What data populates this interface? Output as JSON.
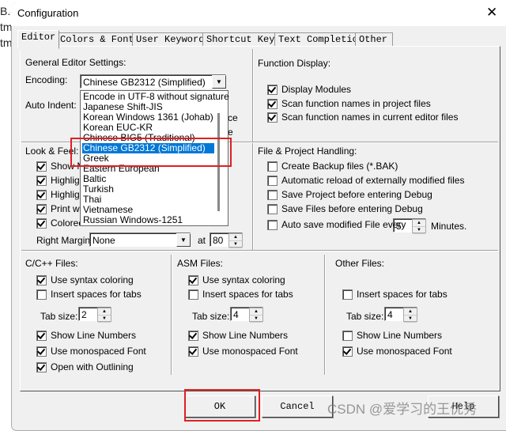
{
  "background": {
    "fragments": [
      "B.c",
      "tm",
      "tm"
    ]
  },
  "dialog": {
    "title": "Configuration",
    "close_icon": "close-icon"
  },
  "tabs": [
    {
      "label": "Editor",
      "active": true
    },
    {
      "label": "Colors & Fonts"
    },
    {
      "label": "User Keywords"
    },
    {
      "label": "Shortcut Keys"
    },
    {
      "label": "Text Completion"
    },
    {
      "label": "Other"
    }
  ],
  "general": {
    "heading": "General Editor Settings:",
    "encoding_label": "Encoding:",
    "encoding_value": "Chinese GB2312 (Simplified)",
    "auto_indent_label": "Auto Indent:",
    "hidden_fragments": [
      "ce",
      "e"
    ],
    "encoding_options": [
      "Encode in UTF-8 without signature",
      "Japanese Shift-JIS",
      "Korean Windows 1361 (Johab)",
      "Korean EUC-KR",
      "Chinese BIG5 (Traditional)",
      "Chinese GB2312 (Simplified)",
      "Greek",
      "Eastern European",
      "Baltic",
      "Turkish",
      "Thai",
      "Vietnamese",
      "Russian Windows-1251"
    ],
    "selected_index": 5
  },
  "function_display": {
    "heading": "Function Display:",
    "items": [
      {
        "label": "Display Modules",
        "checked": true
      },
      {
        "label": "Scan function names in project files",
        "checked": true
      },
      {
        "label": "Scan function names in current editor files",
        "checked": true
      }
    ]
  },
  "look_feel": {
    "heading": "Look & Feel:",
    "items": [
      {
        "label": "Show M",
        "checked": true
      },
      {
        "label": "Highligh",
        "checked": true
      },
      {
        "label": "Highligh",
        "checked": true
      },
      {
        "label": "Print wit",
        "checked": true
      },
      {
        "label": "Colored",
        "checked": true
      }
    ],
    "right_margin_label": "Right Margin:",
    "right_margin_value": "None",
    "at_label": "at",
    "at_value": "80"
  },
  "file_project": {
    "heading": "File & Project Handling:",
    "items": [
      {
        "label": "Create Backup files (*.BAK)",
        "checked": false
      },
      {
        "label": "Automatic reload of externally modified files",
        "checked": false
      },
      {
        "label": "Save Project before entering Debug",
        "checked": false
      },
      {
        "label": "Save Files before entering Debug",
        "checked": false
      },
      {
        "label": "Auto save modified File every",
        "checked": false
      }
    ],
    "autosave_value": "5",
    "minutes_label": "Minutes."
  },
  "cpp": {
    "heading": "C/C++ Files:",
    "syntax": {
      "label": "Use syntax coloring",
      "checked": true
    },
    "spaces": {
      "label": "Insert spaces for tabs",
      "checked": false
    },
    "tab_label": "Tab size:",
    "tab_value": "2",
    "lines": {
      "label": "Show Line Numbers",
      "checked": true
    },
    "mono": {
      "label": "Use monospaced Font",
      "checked": true
    },
    "outline": {
      "label": "Open with Outlining",
      "checked": true
    }
  },
  "asm": {
    "heading": "ASM Files:",
    "syntax": {
      "label": "Use syntax coloring",
      "checked": true
    },
    "spaces": {
      "label": "Insert spaces for tabs",
      "checked": false
    },
    "tab_label": "Tab size:",
    "tab_value": "4",
    "lines": {
      "label": "Show Line Numbers",
      "checked": true
    },
    "mono": {
      "label": "Use monospaced Font",
      "checked": true
    }
  },
  "other": {
    "heading": "Other Files:",
    "spaces": {
      "label": "Insert spaces for tabs",
      "checked": false
    },
    "tab_label": "Tab size:",
    "tab_value": "4",
    "lines": {
      "label": "Show Line Numbers",
      "checked": false
    },
    "mono": {
      "label": "Use monospaced Font",
      "checked": true
    }
  },
  "buttons": {
    "ok": "OK",
    "cancel": "Cancel",
    "help": "Help"
  },
  "watermark": "CSDN @爱学习的王优秀",
  "colors": {
    "highlight": "#0078d7",
    "annotation": "#e02020"
  }
}
